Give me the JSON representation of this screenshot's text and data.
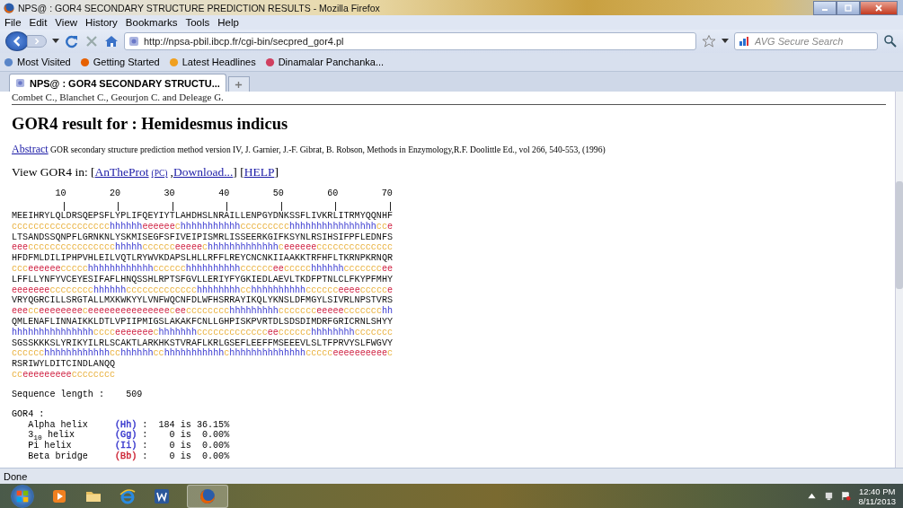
{
  "window": {
    "title": "NPS@ : GOR4 SECONDARY STRUCTURE PREDICTION RESULTS - Mozilla Firefox"
  },
  "menu": [
    "File",
    "Edit",
    "View",
    "History",
    "Bookmarks",
    "Tools",
    "Help"
  ],
  "address": {
    "value": "http://npsa-pbil.ibcp.fr/cgi-bin/secpred_gor4.pl"
  },
  "search": {
    "placeholder": "AVG Secure Search"
  },
  "bookmarks": [
    "Most Visited",
    "Getting Started",
    "Latest Headlines",
    "Dinamalar Panchanka..."
  ],
  "tabs": [
    {
      "label": "NPS@ : GOR4 SECONDARY STRUCTU...",
      "selected": true
    }
  ],
  "page": {
    "authors": "Combet C., Blanchet C., Geourjon C. and Deleage G.",
    "heading": "GOR4 result for : Hemidesmus indicus",
    "abstract_link": "Abstract",
    "abstract_text": "GOR secondary structure prediction method version IV, J. Garnier, J.-F. Gibrat, B. Robson, Methods in Enzymology,R.F. Doolittle Ed., vol 266, 540-553, (1996)",
    "view_parts": [
      {
        "kind": "text",
        "text": "View GOR4 in: ["
      },
      {
        "kind": "link",
        "text": "AnTheProt"
      },
      {
        "kind": "small_link",
        "text": "(PC)"
      },
      {
        "kind": "text",
        "text": ","
      },
      {
        "kind": "link",
        "text": "Download..."
      },
      {
        "kind": "text",
        "text": "] ["
      },
      {
        "kind": "link",
        "text": "HELP"
      },
      {
        "kind": "text",
        "text": "]"
      }
    ],
    "ruler": [
      "10",
      "20",
      "30",
      "40",
      "50",
      "60",
      "70"
    ],
    "blocks": [
      {
        "sequence": "MEEIHRYLQLDRSQEPSFLYPLIFQEYIYTLAHDHSLNRAILLENPGYDNKSSFLIVKRLITRMYQQNHF",
        "prediction": [
          {
            "kind": "coil",
            "text": "cccccccccccccccccc"
          },
          {
            "kind": "helix",
            "text": "hhhhhh"
          },
          {
            "kind": "strand",
            "text": "eeeeee"
          },
          {
            "kind": "coil",
            "text": "c"
          },
          {
            "kind": "helix",
            "text": "hhhhhhhhhhh"
          },
          {
            "kind": "coil",
            "text": "ccccccccc"
          },
          {
            "kind": "helix",
            "text": "hhhhhhhhhhhhhhhh"
          },
          {
            "kind": "coil",
            "text": "cc"
          },
          {
            "kind": "strand",
            "text": "e"
          }
        ]
      },
      {
        "sequence": "LTSANDSSQNPFLGRNKNLYSKMISEGFSFIVEIPISMRLISSEERKGIFKSYNLRSIHSIFPFLEDNFS",
        "prediction": [
          {
            "kind": "strand",
            "text": "eee"
          },
          {
            "kind": "coil",
            "text": "cccccccccccccccc"
          },
          {
            "kind": "helix",
            "text": "hhhhh"
          },
          {
            "kind": "coil",
            "text": "cccccc"
          },
          {
            "kind": "strand",
            "text": "eeeee"
          },
          {
            "kind": "coil",
            "text": "c"
          },
          {
            "kind": "helix",
            "text": "hhhhhhhhhhhhh"
          },
          {
            "kind": "coil",
            "text": "c"
          },
          {
            "kind": "strand",
            "text": "eeeeee"
          },
          {
            "kind": "coil",
            "text": "cccccccccccccc"
          }
        ]
      },
      {
        "sequence": "HFDFMLDILIPHPVHLEILVQTLRYWVKDAPSLHLLRFFLREYCNCNKIIAAKKTRFHFLTKRNPKRNQR",
        "prediction": [
          {
            "kind": "coil",
            "text": "ccc"
          },
          {
            "kind": "strand",
            "text": "eeeeee"
          },
          {
            "kind": "coil",
            "text": "ccccc"
          },
          {
            "kind": "helix",
            "text": "hhhhhhhhhhhh"
          },
          {
            "kind": "coil",
            "text": "cccccc"
          },
          {
            "kind": "helix",
            "text": "hhhhhhhhhh"
          },
          {
            "kind": "coil",
            "text": "cccccc"
          },
          {
            "kind": "strand",
            "text": "ee"
          },
          {
            "kind": "coil",
            "text": "ccccc"
          },
          {
            "kind": "helix",
            "text": "hhhhhh"
          },
          {
            "kind": "coil",
            "text": "ccccccc"
          },
          {
            "kind": "strand",
            "text": "ee"
          }
        ]
      },
      {
        "sequence": "LFFLLYNFYVCEYESIFAFLHNQSSHLRPTSFGVLLERIYFYGKIEDLAEVLTKDFPTNLCLFKYPFMHY",
        "prediction": [
          {
            "kind": "strand",
            "text": "eeeeeee"
          },
          {
            "kind": "coil",
            "text": "cccccccc"
          },
          {
            "kind": "helix",
            "text": "hhhhhh"
          },
          {
            "kind": "coil",
            "text": "ccccccccccccc"
          },
          {
            "kind": "helix",
            "text": "hhhhhhhh"
          },
          {
            "kind": "coil",
            "text": "cc"
          },
          {
            "kind": "helix",
            "text": "hhhhhhhhhh"
          },
          {
            "kind": "coil",
            "text": "cccccc"
          },
          {
            "kind": "strand",
            "text": "eeee"
          },
          {
            "kind": "coil",
            "text": "ccccc"
          },
          {
            "kind": "strand",
            "text": "e"
          }
        ]
      },
      {
        "sequence": "VRYQGRCILLSRGTALLMXKWKYYLVNFWQCNFDLWFHSRRAYIKQLYKNSLDFMGYLSIVRLNPSTVRS",
        "prediction": [
          {
            "kind": "strand",
            "text": "eee"
          },
          {
            "kind": "coil",
            "text": "cc"
          },
          {
            "kind": "strand",
            "text": "eeeeeeee"
          },
          {
            "kind": "coil",
            "text": "c"
          },
          {
            "kind": "strand",
            "text": "eeeeeeeeeeeeeee"
          },
          {
            "kind": "coil",
            "text": "c"
          },
          {
            "kind": "strand",
            "text": "ee"
          },
          {
            "kind": "coil",
            "text": "cccccccc"
          },
          {
            "kind": "helix",
            "text": "hhhhhhhhh"
          },
          {
            "kind": "coil",
            "text": "ccccccc"
          },
          {
            "kind": "strand",
            "text": "eeeee"
          },
          {
            "kind": "coil",
            "text": "ccccccc"
          },
          {
            "kind": "helix",
            "text": "hh"
          }
        ]
      },
      {
        "sequence": "QMLENAFLINNAIKKLDTLVPIIPMIGSLAKAKFCNLLGHPISKPVRTDLSDSDIMDRFGRICRNLSHYY",
        "prediction": [
          {
            "kind": "helix",
            "text": "hhhhhhhhhhhhhhh"
          },
          {
            "kind": "coil",
            "text": "cccc"
          },
          {
            "kind": "strand",
            "text": "eeeeeee"
          },
          {
            "kind": "coil",
            "text": "c"
          },
          {
            "kind": "helix",
            "text": "hhhhhhh"
          },
          {
            "kind": "coil",
            "text": "ccccccccccccc"
          },
          {
            "kind": "strand",
            "text": "ee"
          },
          {
            "kind": "coil",
            "text": "cccccc"
          },
          {
            "kind": "helix",
            "text": "hhhhhhhh"
          },
          {
            "kind": "coil",
            "text": "ccccccc"
          }
        ]
      },
      {
        "sequence": "SGSSKKKSLYRIKYILRLSCAKTLARKHKSTVRAFLKRLGSEFLEEFFMSEEEVLSLTFPRVYSLFWGVY",
        "prediction": [
          {
            "kind": "coil",
            "text": "cccccc"
          },
          {
            "kind": "helix",
            "text": "hhhhhhhhhhhh"
          },
          {
            "kind": "coil",
            "text": "cc"
          },
          {
            "kind": "helix",
            "text": "hhhhhh"
          },
          {
            "kind": "coil",
            "text": "cc"
          },
          {
            "kind": "helix",
            "text": "hhhhhhhhhhh"
          },
          {
            "kind": "coil",
            "text": "c"
          },
          {
            "kind": "helix",
            "text": "hhhhhhhhhhhhhh"
          },
          {
            "kind": "coil",
            "text": "ccccc"
          },
          {
            "kind": "strand",
            "text": "eeeeeeeeee"
          },
          {
            "kind": "coil",
            "text": "c"
          }
        ]
      },
      {
        "sequence": "RSRIWYLDITCINDLANQQ",
        "prediction": [
          {
            "kind": "coil",
            "text": "cc"
          },
          {
            "kind": "strand",
            "text": "eeeeeeeee"
          },
          {
            "kind": "coil",
            "text": "cccccccc"
          }
        ]
      }
    ],
    "length_label": "Sequence length :",
    "length_value": "509",
    "method_label": "GOR4 :",
    "stats": [
      {
        "name": "Alpha helix",
        "code": "(Hh)",
        "color": "#3333cc",
        "sep": ":",
        "count": "184",
        "is": "is",
        "percent": "36.15%"
      },
      {
        "name": "3$_{10}$ helix",
        "code": "(Gg)",
        "color": "#3333cc",
        "sep": ":",
        "count": "0",
        "is": "is",
        "percent": "0.00%"
      },
      {
        "name": "Pi helix",
        "code": "(Ii)",
        "color": "#3333cc",
        "sep": ":",
        "count": "0",
        "is": "is",
        "percent": "0.00%"
      },
      {
        "name": "Beta bridge",
        "code": "(Bb)",
        "color": "#cc2233",
        "sep": ":",
        "count": "0",
        "is": "is",
        "percent": "0.00%"
      }
    ]
  },
  "status_bar": "Done",
  "clock": {
    "time": "12:40 PM",
    "date": "8/11/2013"
  }
}
